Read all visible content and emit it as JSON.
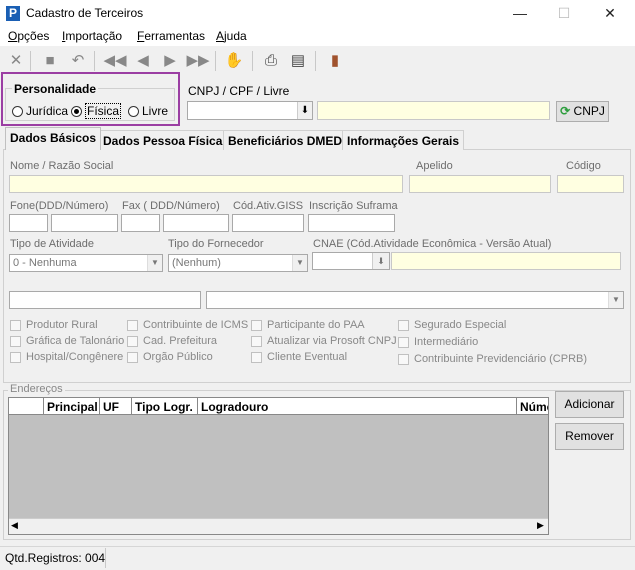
{
  "window": {
    "title": "Cadastro de Terceiros",
    "minimize": "—",
    "maximize": "☐",
    "close": "✕"
  },
  "menu": [
    {
      "label": "Opções",
      "u": "O",
      "rest": "pções"
    },
    {
      "label": "Importação",
      "u": "I",
      "rest": "mportação"
    },
    {
      "label": "Ferramentas",
      "u": "F",
      "rest": "erramentas"
    },
    {
      "label": "Ajuda",
      "u": "A",
      "rest": "juda"
    }
  ],
  "personalidade": {
    "title": "Personalidade",
    "options": [
      "Jurídica",
      "Física",
      "Livre"
    ],
    "selected": "Física"
  },
  "cnpj": {
    "label": "CNPJ / CPF / Livre",
    "value": "",
    "button_label": "CNPJ"
  },
  "tabs": [
    "Dados Básicos",
    "Dados Pessoa Física",
    "Beneficiários DMED",
    "Informações Gerais"
  ],
  "active_tab": "Dados Básicos",
  "fields": {
    "nome_label": "Nome / Razão Social",
    "apelido_label": "Apelido",
    "codigo_label": "Código",
    "fone_label": "Fone(DDD/Número)",
    "fax_label": "Fax ( DDD/Número)",
    "cod_ativ_label": "Cód.Ativ.GISS",
    "inscricao_label": "Inscrição Suframa",
    "tipo_atividade_label": "Tipo de Atividade",
    "tipo_atividade_value": "0 - Nenhuma",
    "tipo_fornecedor_label": "Tipo do Fornecedor",
    "tipo_fornecedor_value": "(Nenhum)",
    "cnae_label": "CNAE (Cód.Atividade Econômica - Versão Atual)"
  },
  "checkboxes": {
    "col1": [
      "Produtor Rural",
      "Gráfica de Talonário",
      "Hospital/Congênere"
    ],
    "col2": [
      "Contribuinte de ICMS",
      "Cad. Prefeitura",
      "Orgão Público"
    ],
    "col3": [
      "Participante do PAA",
      "Atualizar via Prosoft CNPJ",
      "Cliente Eventual"
    ],
    "col4": [
      "Segurado Especial",
      "Intermediário",
      "Contribuinte Previdenciário (CPRB)"
    ]
  },
  "enderecos": {
    "title": "Endereços",
    "columns": [
      "Principal",
      "UF",
      "Tipo Logr.",
      "Logradouro",
      "Núme"
    ],
    "add_button": "Adicionar",
    "remove_button": "Remover"
  },
  "status": {
    "text": "Qtd.Registros: 004"
  },
  "colors": {
    "highlight_border": "#9b3ea3",
    "yellow_field": "#ffffe1",
    "grid_bg": "#c0c0c0"
  }
}
